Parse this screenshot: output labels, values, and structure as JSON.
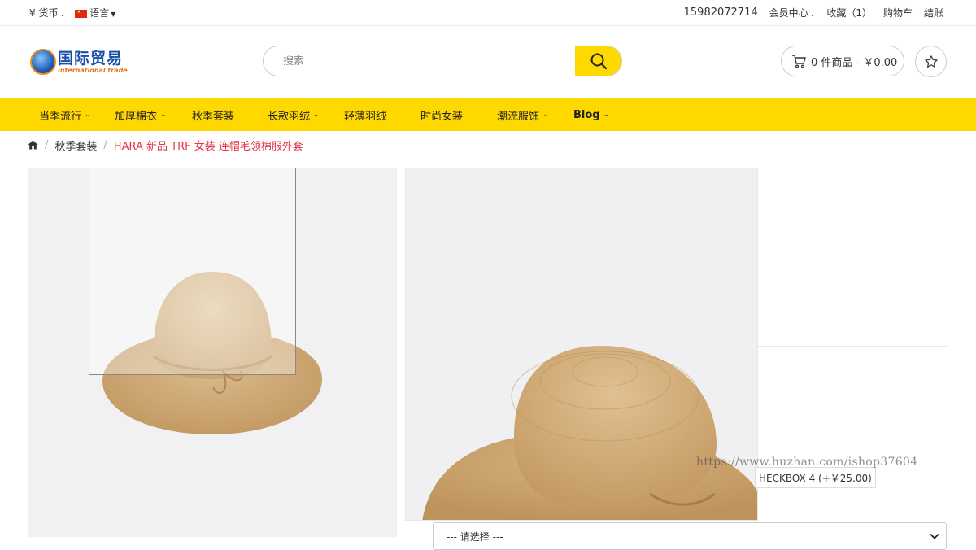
{
  "topbar": {
    "currency_symbol": "¥",
    "currency_label": "货币",
    "language_label": "语言",
    "phone": "15982072714",
    "links": [
      "会员中心",
      "收藏（1）",
      "购物车",
      "结账"
    ]
  },
  "logo": {
    "cn": "国际贸易",
    "en": "international trade"
  },
  "search": {
    "placeholder": "搜索"
  },
  "cart": {
    "text": "0 件商品 - ￥0.00"
  },
  "nav": {
    "items": [
      {
        "label": "当季流行",
        "dropdown": true
      },
      {
        "label": "加厚棉衣",
        "dropdown": true
      },
      {
        "label": "秋季套装",
        "dropdown": false
      },
      {
        "label": "长款羽绒",
        "dropdown": true
      },
      {
        "label": "轻薄羽绒",
        "dropdown": false
      },
      {
        "label": "时尚女装",
        "dropdown": false
      },
      {
        "label": "潮流服饰",
        "dropdown": true
      },
      {
        "label": "Blog",
        "dropdown": true
      }
    ]
  },
  "breadcrumb": {
    "parent": "秋季套装",
    "current": "HARA 新品 TRF 女装 连帽毛领棉服外套"
  },
  "options": {
    "checkbox_label": "HECKBOX 4 (+￥25.00)",
    "select_placeholder": "--- 请选择 ---"
  },
  "watermark": "https://www.huzhan.com/ishop37604",
  "colors": {
    "accent": "#ffd800",
    "breadcrumb_active": "#e3344a"
  }
}
